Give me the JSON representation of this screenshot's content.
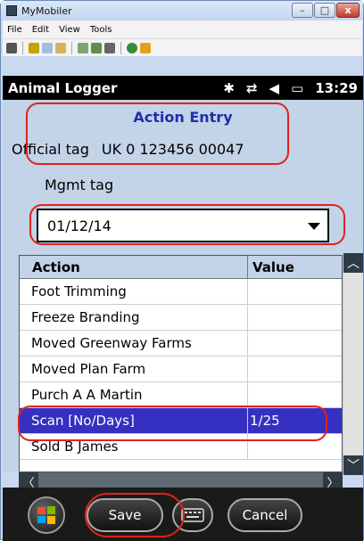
{
  "window": {
    "title": "MyMobiler",
    "minimize": "–",
    "maximize": "□",
    "close": "x"
  },
  "menu": [
    "File",
    "Edit",
    "View",
    "Tools"
  ],
  "status_bar": {
    "app_name": "Animal Logger",
    "time": "13:29",
    "icons": [
      "bluetooth-icon",
      "data-connection-icon",
      "speaker-muted-icon",
      "battery-icon"
    ]
  },
  "form": {
    "title": "Action Entry",
    "official_tag_label": "Official tag",
    "official_tag_value": "UK 0 123456 00047",
    "mgmt_tag_label": "Mgmt tag",
    "date_value": "01/12/14"
  },
  "table": {
    "headers": [
      "Action",
      "Value"
    ],
    "rows": [
      {
        "action": "Foot Trimming",
        "value": ""
      },
      {
        "action": "Freeze Branding",
        "value": ""
      },
      {
        "action": "Moved Greenway Farms",
        "value": ""
      },
      {
        "action": "Moved Plan Farm",
        "value": ""
      },
      {
        "action": "Purch A A Martin",
        "value": ""
      },
      {
        "action": "Scan [No/Days]",
        "value": "1/25",
        "selected": true
      },
      {
        "action": "Sold B James",
        "value": ""
      }
    ]
  },
  "softkeys": {
    "save": "Save",
    "cancel": "Cancel"
  },
  "colors": {
    "title_blue": "#1f2fa8",
    "selection": "#3530c2",
    "annotation_red": "#e2231a"
  }
}
